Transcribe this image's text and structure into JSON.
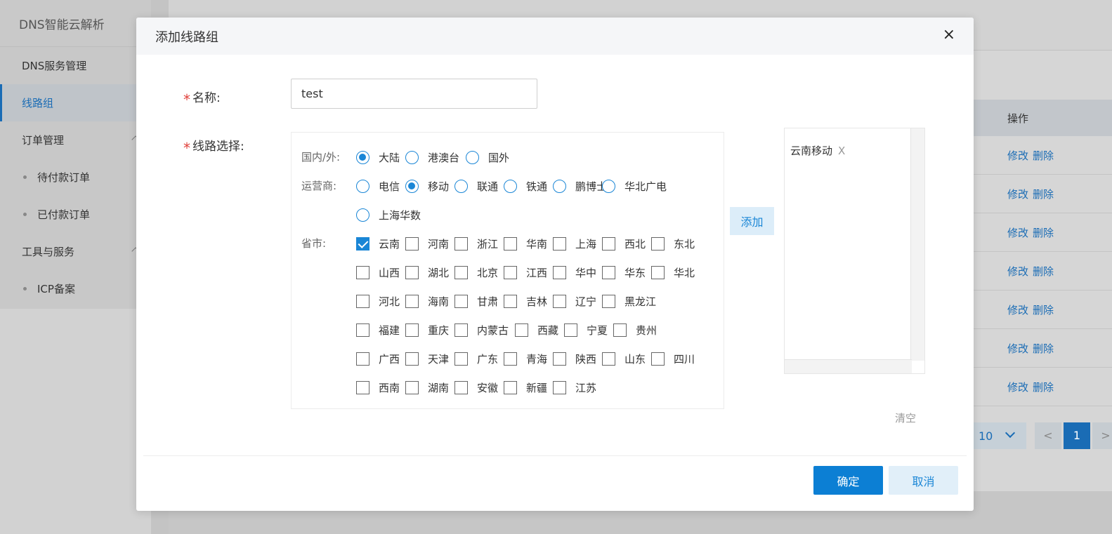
{
  "app": {
    "title": "DNS智能云解析",
    "sidebar": [
      {
        "label": "DNS服务管理",
        "active": false,
        "sub": false
      },
      {
        "label": "线路组",
        "active": true,
        "sub": false
      },
      {
        "label": "订单管理",
        "active": false,
        "sub": false,
        "expandable": true
      },
      {
        "label": "待付款订单",
        "active": false,
        "sub": true
      },
      {
        "label": "已付款订单",
        "active": false,
        "sub": true
      },
      {
        "label": "工具与服务",
        "active": false,
        "sub": false,
        "expandable": true
      },
      {
        "label": "ICP备案",
        "active": false,
        "sub": true
      }
    ],
    "table": {
      "op_header": "操作",
      "edit_label": "修改",
      "delete_label": "删除",
      "row_count": 7
    },
    "pager": {
      "page_size": "10",
      "prev": "<",
      "current": "1",
      "next": ">"
    }
  },
  "modal": {
    "title": "添加线路组",
    "close": "×",
    "name_label": "名称:",
    "name_value": "test",
    "route_label": "线路选择:",
    "region_label": "国内/外:",
    "regions": [
      {
        "label": "大陆",
        "selected": true
      },
      {
        "label": "港澳台",
        "selected": false
      },
      {
        "label": "国外",
        "selected": false
      }
    ],
    "isp_label": "运营商:",
    "isps": [
      {
        "label": "电信",
        "selected": false
      },
      {
        "label": "移动",
        "selected": true
      },
      {
        "label": "联通",
        "selected": false
      },
      {
        "label": "铁通",
        "selected": false
      },
      {
        "label": "鹏博士",
        "selected": false
      },
      {
        "label": "华北广电",
        "selected": false
      },
      {
        "label": "上海华数",
        "selected": false
      }
    ],
    "province_label": "省市:",
    "provinces": [
      [
        {
          "label": "云南",
          "checked": true
        },
        {
          "label": "河南",
          "checked": false
        },
        {
          "label": "浙江",
          "checked": false
        },
        {
          "label": "华南",
          "checked": false
        },
        {
          "label": "上海",
          "checked": false
        },
        {
          "label": "西北",
          "checked": false
        },
        {
          "label": "东北",
          "checked": false
        }
      ],
      [
        {
          "label": "山西",
          "checked": false
        },
        {
          "label": "湖北",
          "checked": false
        },
        {
          "label": "北京",
          "checked": false
        },
        {
          "label": "江西",
          "checked": false
        },
        {
          "label": "华中",
          "checked": false
        },
        {
          "label": "华东",
          "checked": false
        },
        {
          "label": "华北",
          "checked": false
        }
      ],
      [
        {
          "label": "河北",
          "checked": false
        },
        {
          "label": "海南",
          "checked": false
        },
        {
          "label": "甘肃",
          "checked": false
        },
        {
          "label": "吉林",
          "checked": false
        },
        {
          "label": "辽宁",
          "checked": false
        },
        {
          "label": "黑龙江",
          "checked": false
        }
      ],
      [
        {
          "label": "福建",
          "checked": false
        },
        {
          "label": "重庆",
          "checked": false
        },
        {
          "label": "内蒙古",
          "checked": false
        },
        {
          "label": "西藏",
          "checked": false
        },
        {
          "label": "宁夏",
          "checked": false
        },
        {
          "label": "贵州",
          "checked": false
        }
      ],
      [
        {
          "label": "广西",
          "checked": false
        },
        {
          "label": "天津",
          "checked": false
        },
        {
          "label": "广东",
          "checked": false
        },
        {
          "label": "青海",
          "checked": false
        },
        {
          "label": "陕西",
          "checked": false
        },
        {
          "label": "山东",
          "checked": false
        },
        {
          "label": "四川",
          "checked": false
        }
      ],
      [
        {
          "label": "西南",
          "checked": false
        },
        {
          "label": "湖南",
          "checked": false
        },
        {
          "label": "安徽",
          "checked": false
        },
        {
          "label": "新疆",
          "checked": false
        },
        {
          "label": "江苏",
          "checked": false
        }
      ]
    ],
    "add_label": "添加",
    "selected_items": [
      "云南移动"
    ],
    "remove_label": "X",
    "clear_label": "清空",
    "ok_label": "确定",
    "cancel_label": "取消"
  },
  "colors": {
    "primary": "#0c7fd4",
    "accent": "#1a86d6",
    "required": "#e0413b"
  }
}
